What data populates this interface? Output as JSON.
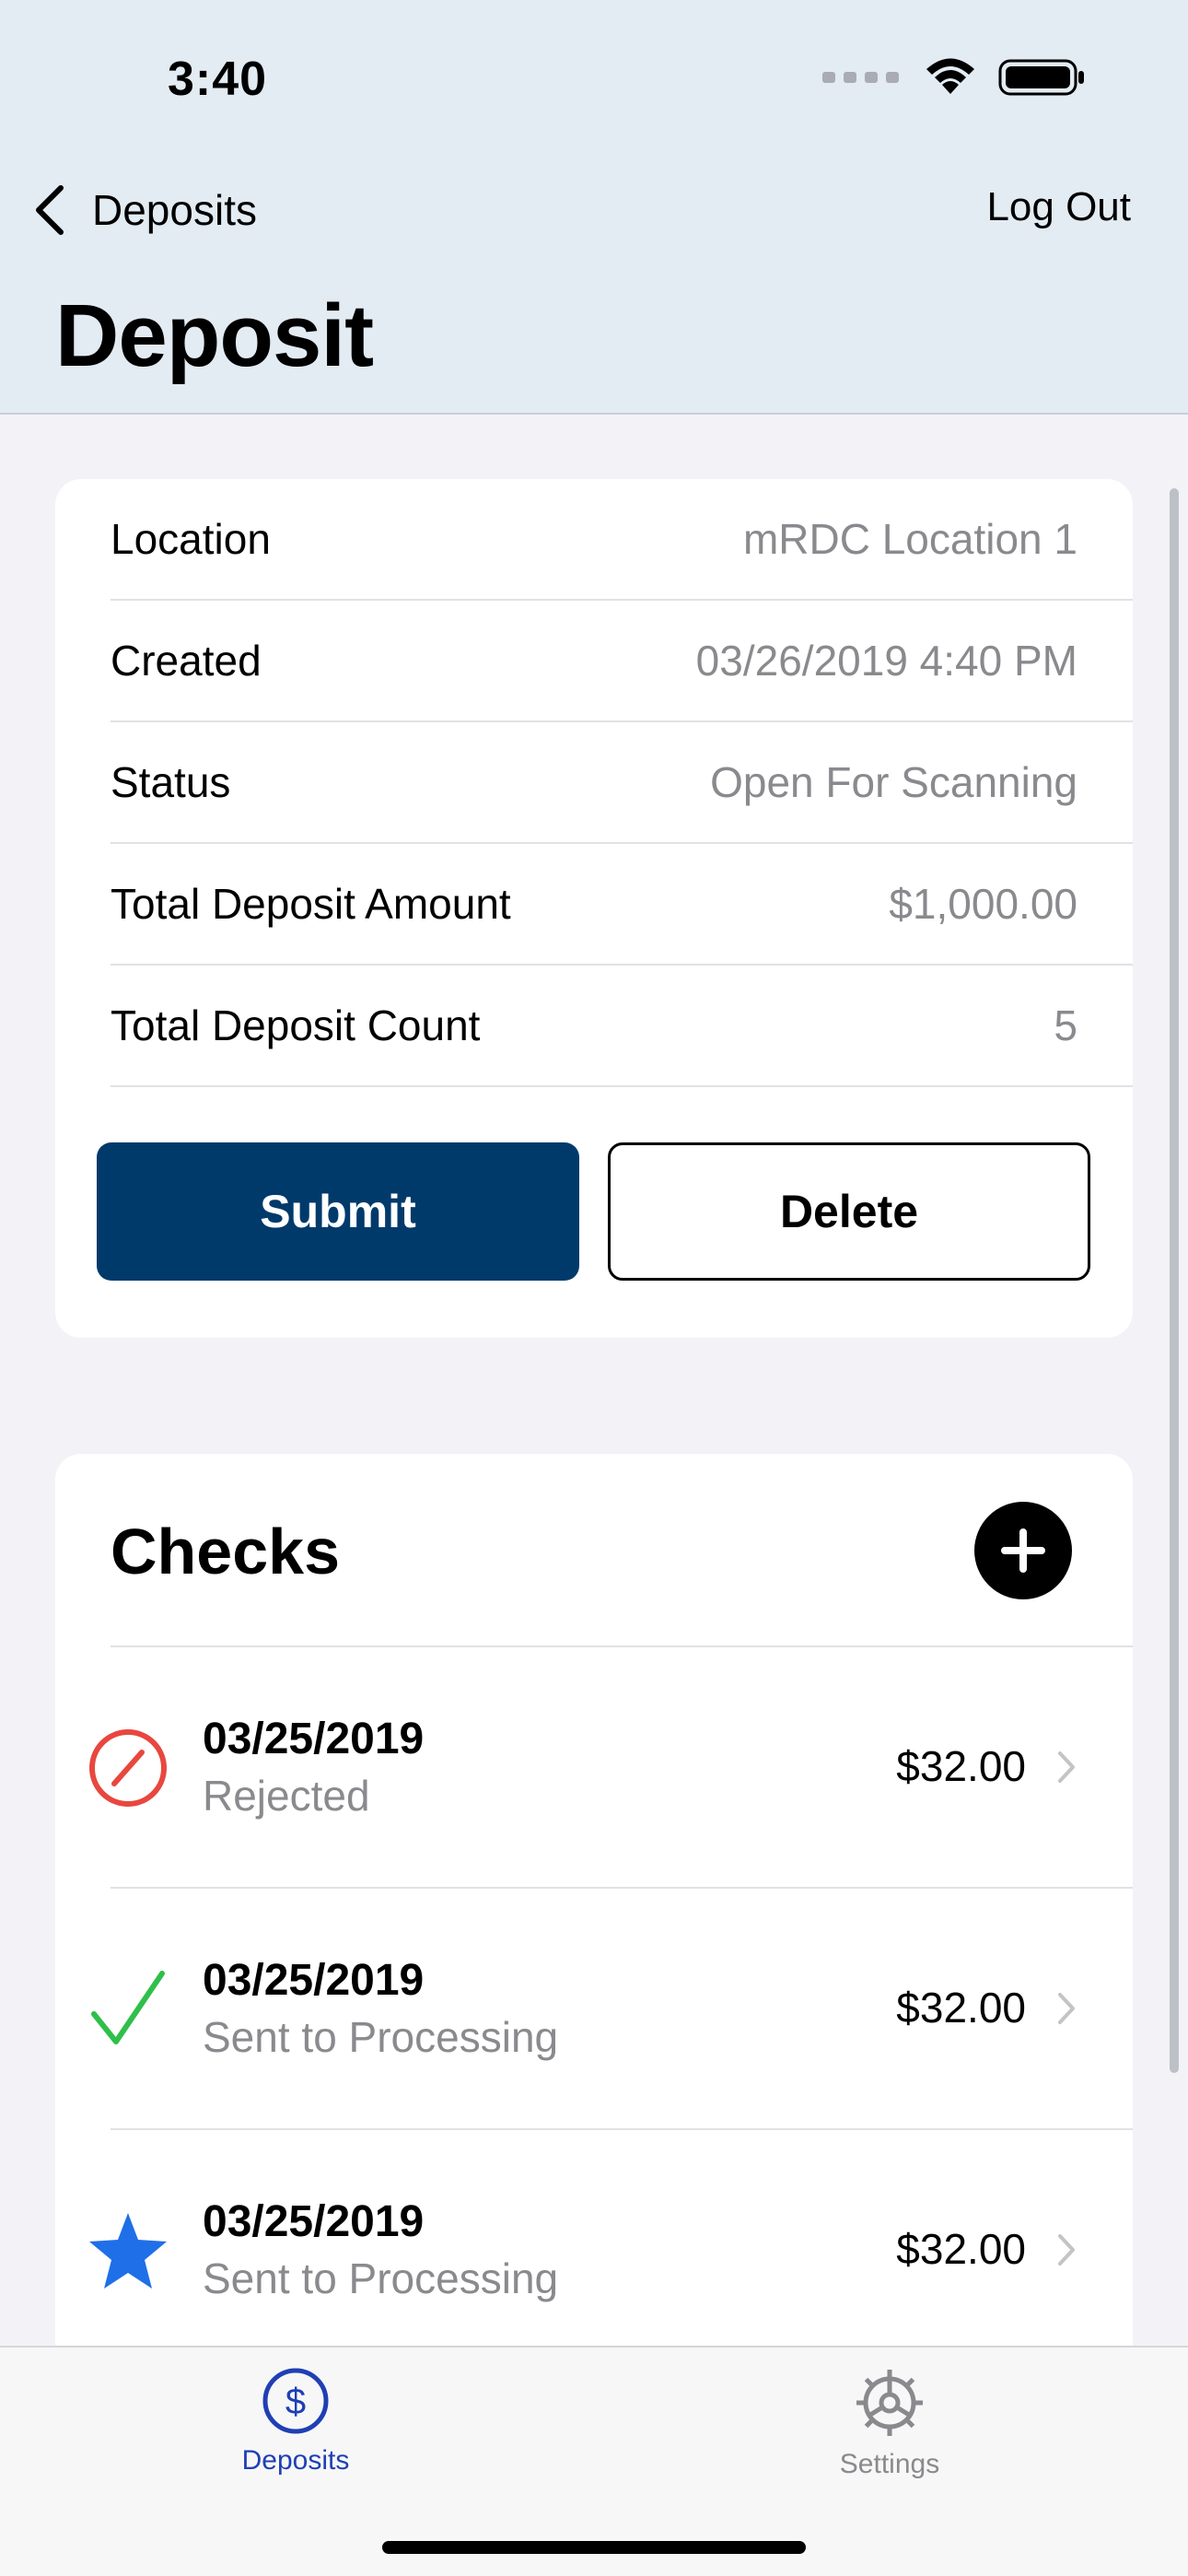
{
  "status_bar": {
    "time": "3:40"
  },
  "nav": {
    "back_label": "Deposits",
    "logout_label": "Log Out",
    "title": "Deposit"
  },
  "details": [
    {
      "label": "Location",
      "value": "mRDC Location 1"
    },
    {
      "label": "Created",
      "value": "03/26/2019 4:40 PM"
    },
    {
      "label": "Status",
      "value": "Open For Scanning"
    },
    {
      "label": "Total Deposit Amount",
      "value": "$1,000.00"
    },
    {
      "label": "Total Deposit Count",
      "value": "5"
    }
  ],
  "actions": {
    "submit_label": "Submit",
    "delete_label": "Delete"
  },
  "checks": {
    "title": "Checks",
    "items": [
      {
        "date": "03/25/2019",
        "status": "Rejected",
        "amount": "$32.00",
        "icon": "rejected-icon"
      },
      {
        "date": "03/25/2019",
        "status": "Sent to Processing",
        "amount": "$32.00",
        "icon": "checkmark-icon"
      },
      {
        "date": "03/25/2019",
        "status": "Sent to Processing",
        "amount": "$32.00",
        "icon": "star-icon"
      }
    ]
  },
  "tabs": [
    {
      "label": "Deposits",
      "icon": "dollar-circle-icon",
      "active": true
    },
    {
      "label": "Settings",
      "icon": "gear-icon",
      "active": false
    }
  ],
  "colors": {
    "header_bg": "#e3ebf3",
    "submit_bg": "#003a6b",
    "rejected": "#e8473f",
    "approved": "#2fbf4a",
    "star": "#1f6fe8",
    "active_tab": "#1f3fb5"
  }
}
